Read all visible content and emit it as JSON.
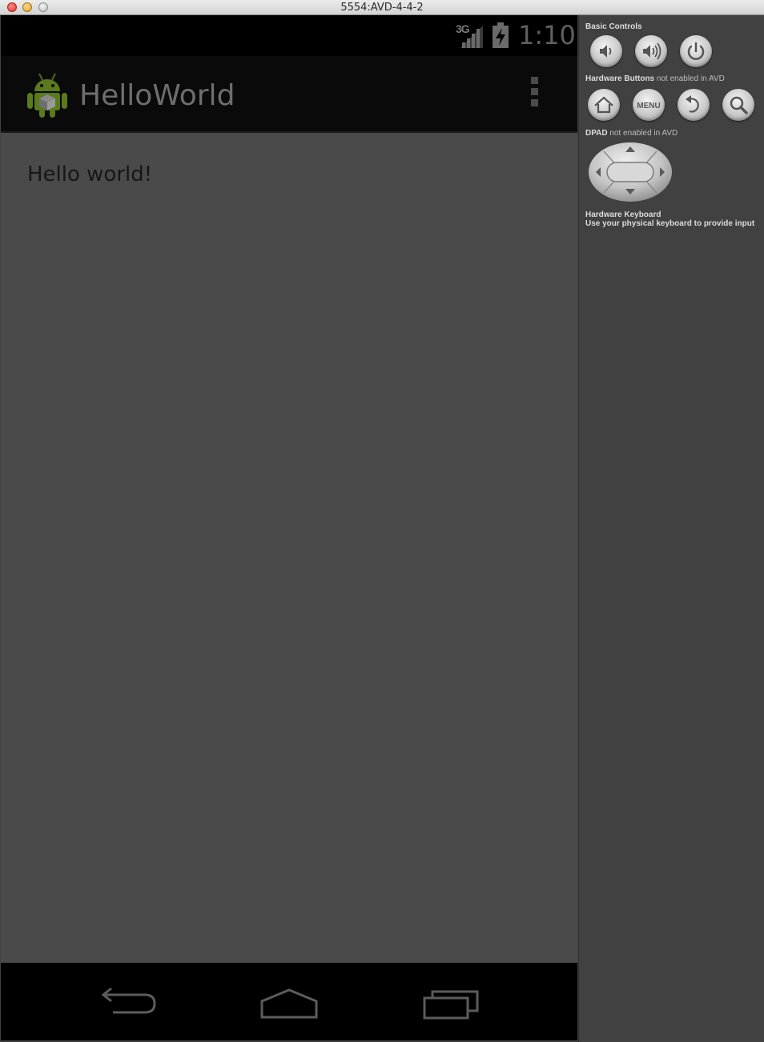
{
  "window": {
    "title": "5554:AVD-4-4-2"
  },
  "statusbar": {
    "network_label": "3G",
    "clock": "1:10"
  },
  "actionbar": {
    "app_title": "HelloWorld"
  },
  "content": {
    "text": "Hello world!"
  },
  "panel": {
    "basic_controls": "Basic Controls",
    "hardware_buttons": "Hardware Buttons",
    "hardware_buttons_note": "not enabled in AVD",
    "dpad": "DPAD",
    "dpad_note": "not enabled in AVD",
    "keyboard_title": "Hardware Keyboard",
    "keyboard_note": "Use your physical keyboard to provide input",
    "menu_label": "MENU"
  },
  "icons": {
    "volume_down": "volume-down-icon",
    "volume_up": "volume-up-icon",
    "power": "power-icon",
    "home": "home-icon",
    "menu": "menu-icon",
    "back": "back-icon",
    "search": "search-icon"
  },
  "colors": {
    "screen_bg": "#4a4a4a",
    "actionbar_bg": "#0a0a0a",
    "panel_bg": "#414141",
    "android_green": "#5a7a1c"
  }
}
